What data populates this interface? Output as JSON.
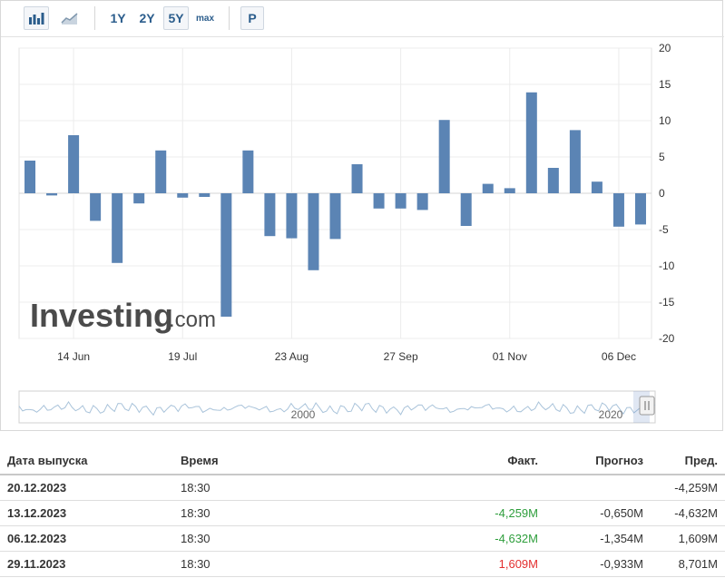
{
  "toolbar": {
    "bar_icon": "bar-chart-icon",
    "line_icon": "line-chart-icon",
    "ranges": [
      "1Y",
      "2Y",
      "5Y",
      "max"
    ],
    "active_range": "5Y",
    "p_label": "P"
  },
  "colors": {
    "bar": "#5b84b4",
    "positive": "#2e9e3c",
    "negative": "#e32f2f",
    "navigator_line": "#a9c3da"
  },
  "watermark": {
    "brand": "Investing",
    "suffix": ".com"
  },
  "chart_data": {
    "type": "bar",
    "x_tick_labels": [
      "14 Jun",
      "19 Jul",
      "23 Aug",
      "27 Sep",
      "01 Nov",
      "06 Dec"
    ],
    "y_ticks": [
      20,
      15,
      10,
      5,
      0,
      -5,
      -10,
      -15,
      -20
    ],
    "ylim": [
      -20,
      20
    ],
    "grid": true,
    "y_axis_side": "right",
    "values": [
      4.5,
      -0.3,
      8.0,
      -3.8,
      -9.6,
      -1.4,
      5.9,
      -0.6,
      -0.5,
      -17.0,
      5.9,
      -5.9,
      -6.2,
      -10.6,
      -6.3,
      4.0,
      -2.1,
      -2.1,
      -2.3,
      10.1,
      -4.5,
      1.3,
      0.7,
      13.9,
      3.5,
      8.7,
      1.6,
      -4.6,
      -4.3
    ],
    "navigator_labels": [
      "2000",
      "2020"
    ]
  },
  "table": {
    "headers": {
      "date": "Дата выпуска",
      "time": "Время",
      "actual": "Факт.",
      "forecast": "Прогноз",
      "previous": "Пред."
    },
    "rows": [
      {
        "date": "20.12.2023",
        "time": "18:30",
        "actual": "",
        "actual_state": "",
        "forecast": "",
        "previous": "-4,259M"
      },
      {
        "date": "13.12.2023",
        "time": "18:30",
        "actual": "-4,259M",
        "actual_state": "pos",
        "forecast": "-0,650M",
        "previous": "-4,632M"
      },
      {
        "date": "06.12.2023",
        "time": "18:30",
        "actual": "-4,632M",
        "actual_state": "pos",
        "forecast": "-1,354M",
        "previous": "1,609M"
      },
      {
        "date": "29.11.2023",
        "time": "18:30",
        "actual": "1,609M",
        "actual_state": "neg",
        "forecast": "-0,933M",
        "previous": "8,701M"
      }
    ]
  }
}
